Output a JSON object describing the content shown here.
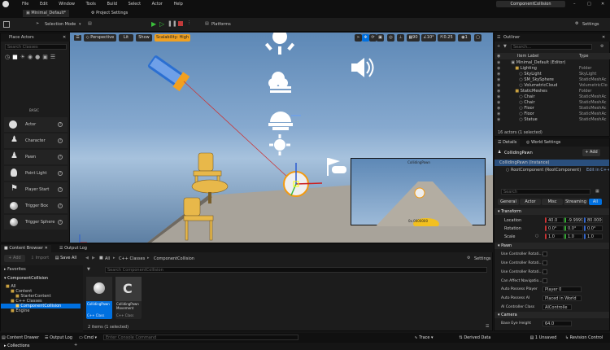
{
  "menu": [
    "File",
    "Edit",
    "Window",
    "Tools",
    "Build",
    "Select",
    "Actor",
    "Help"
  ],
  "window_title": "ComponentCollision",
  "tabs": {
    "level": "Minimal_Default*",
    "project_settings": "Project Settings"
  },
  "toolbar": {
    "selection_mode": "Selection Mode",
    "platforms": "Platforms",
    "settings": "Settings"
  },
  "place_actors": {
    "title": "Place Actors",
    "search_placeholder": "Search Classes",
    "category": "BASIC",
    "items": [
      "Actor",
      "Character",
      "Pawn",
      "Point Light",
      "Player Start",
      "Trigger Box",
      "Trigger Sphere"
    ]
  },
  "viewport": {
    "perspective": "Perspective",
    "lit": "Lit",
    "show": "Show",
    "scalability": "Scalability: High",
    "fov": "90",
    "snap_angle": "10°",
    "snap_scale": "0.25",
    "camera_speed": "1",
    "pip_title": "CollidingPawn",
    "pip_value": "0x.0000000"
  },
  "outliner": {
    "title": "Outliner",
    "search_placeholder": "Search...",
    "col_label": "Item Label",
    "col_type": "Type",
    "rows": [
      {
        "label": "Minimal_Default (Editor)",
        "type": ""
      },
      {
        "label": "Lighting",
        "type": "Folder"
      },
      {
        "label": "SkyLight",
        "type": "SkyLight"
      },
      {
        "label": "SM_SkySphere",
        "type": "StaticMeshAc"
      },
      {
        "label": "VolumetricCloud",
        "type": "VolumetricClo"
      },
      {
        "label": "StaticMeshes",
        "type": "Folder"
      },
      {
        "label": "Chair",
        "type": "StaticMeshAc"
      },
      {
        "label": "Chair",
        "type": "StaticMeshAc"
      },
      {
        "label": "Floor",
        "type": "StaticMeshAc"
      },
      {
        "label": "Floor",
        "type": "StaticMeshAc"
      },
      {
        "label": "Statue",
        "type": "StaticMeshAc"
      }
    ],
    "status": "16 actors (1 selected)"
  },
  "details": {
    "tab_details": "Details",
    "tab_world": "World Settings",
    "actor_name": "CollidingPawn",
    "add": "+ Add",
    "instance": "CollidingPawn (Instance)",
    "root": "RootComponent (RootComponent)",
    "edit_cpp": "Edit in C++",
    "search_placeholder": "Search",
    "filters": [
      "General",
      "Actor",
      "Misc",
      "Streaming",
      "All"
    ],
    "transform": "Transform",
    "location_label": "Location",
    "location": [
      "40.0",
      "-9.9999",
      "80.0000"
    ],
    "rotation_label": "Rotation",
    "rotation": [
      "0.0°",
      "0.0°",
      "0.0°"
    ],
    "scale_label": "Scale",
    "scale": [
      "1.0",
      "1.0",
      "1.0"
    ],
    "pawn": "Pawn",
    "pawn_rows": [
      "Use Controller Rotati...",
      "Use Controller Rotati...",
      "Use Controller Rotati...",
      "Can Affect Navigatio...",
      "Auto Possess Player",
      "Auto Possess AI",
      "AI Controller Class"
    ],
    "auto_possess_player": "Player 0",
    "auto_possess_ai": "Placed in World",
    "ai_controller": "AIControlle",
    "camera": "Camera",
    "base_eye_label": "Base Eye Height",
    "base_eye": "64.0"
  },
  "content_browser": {
    "title": "Content Browser",
    "output_tab": "Output Log",
    "add": "+ Add",
    "import": "Import",
    "save_all": "Save All",
    "path": [
      "All",
      "C++ Classes",
      "ComponentCollision"
    ],
    "settings": "Settings",
    "favorites": "Favorites",
    "project": "ComponentCollision",
    "search_placeholder": "Search ComponentCollision",
    "tree": [
      "All",
      "Content",
      "StarterContent",
      "C++ Classes",
      "ComponentCollision",
      "Engine"
    ],
    "collections": "Collections",
    "assets": [
      {
        "name": "CollidingPawn",
        "type": "C++ Class"
      },
      {
        "name": "CollidingPawn Movement",
        "type": "C++ Class"
      }
    ],
    "count": "2 items (1 selected)"
  },
  "statusbar": {
    "drawer": "Content Drawer",
    "output": "Output Log",
    "cmd": "Cmd",
    "console_placeholder": "Enter Console Command",
    "trace": "Trace",
    "derived": "Derived Data",
    "unsaved": "1 Unsaved",
    "revision": "Revision Control"
  },
  "colors": {
    "accent": "#0070e0",
    "sky": "#5b87b5",
    "floor": "#a8a39a"
  }
}
